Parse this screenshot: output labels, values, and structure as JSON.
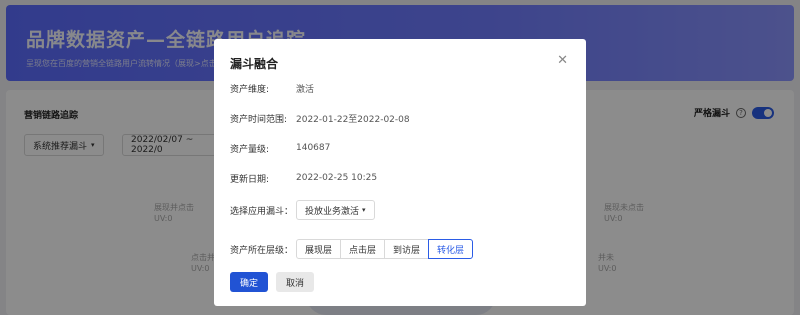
{
  "banner": {
    "title": "品牌数据资产—全链路用户追踪",
    "subtitle": "呈现您在百度的营销全链路用户流转情况（展现>点击>访"
  },
  "page": {
    "section_title": "营销链路追踪",
    "strict_funnel_label": "严格漏斗",
    "funnel_select": "系统推荐漏斗",
    "date_range": "2022/02/07 ~ 2022/0",
    "ghost_labels": [
      {
        "text": "展现并点击",
        "uv": "UV:0"
      },
      {
        "text": "展现未点击",
        "uv": "UV:0"
      },
      {
        "text": "点击并",
        "uv": "UV:0"
      },
      {
        "text": "并未",
        "uv": "UV:0"
      }
    ]
  },
  "modal": {
    "title": "漏斗融合",
    "fields": [
      {
        "label": "资产维度:",
        "value": "激活"
      },
      {
        "label": "资产时间范围:",
        "value": "2022-01-22至2022-02-08"
      },
      {
        "label": "资产量级:",
        "value": "140687"
      },
      {
        "label": "更新日期:",
        "value": "2022-02-25 10:25"
      }
    ],
    "apply_funnel_label": "选择应用漏斗：",
    "apply_funnel_value": "投放业务激活",
    "layer_label": "资产所在层级：",
    "layers": [
      "展现层",
      "点击层",
      "到访层",
      "转化层"
    ],
    "active_layer": "转化层",
    "confirm": "确定",
    "cancel": "取消"
  }
}
